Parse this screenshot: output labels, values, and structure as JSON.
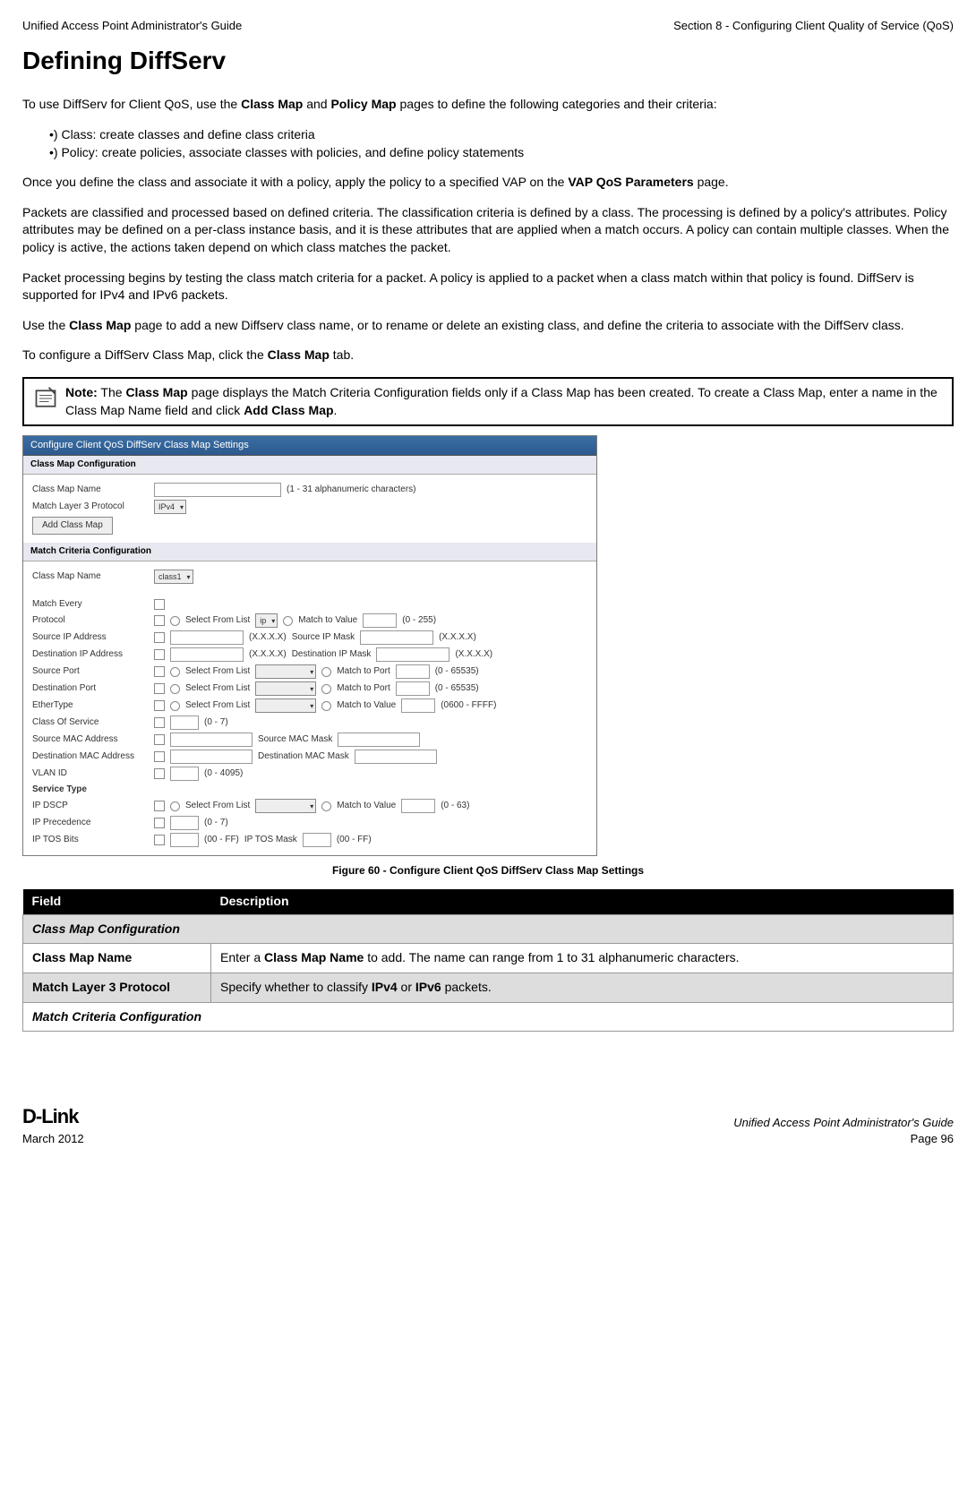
{
  "header": {
    "left": "Unified Access Point Administrator's Guide",
    "right": "Section 8 - Configuring Client Quality of Service (QoS)"
  },
  "title": "Defining DiffServ",
  "para1a": "To use DiffServ for Client QoS, use the ",
  "para1b": "Class Map",
  "para1c": " and ",
  "para1d": "Policy Map",
  "para1e": " pages to define the following categories and their criteria:",
  "bullet1": "•)  Class: create classes and define class criteria",
  "bullet2": "•)  Policy: create policies, associate classes with policies, and define policy statements",
  "para2a": "Once you define the class and associate it with a policy, apply the policy to a specified VAP on the ",
  "para2b": "VAP QoS Parameters",
  "para2c": " page.",
  "para3": "Packets are classified and processed based on defined criteria. The classification criteria is defined by a class. The processing is defined by a policy's attributes. Policy attributes may be defined on a per-class instance basis, and it is these attributes that are applied when a match occurs. A policy can contain multiple classes. When the policy is active, the actions taken depend on which class matches the packet.",
  "para4": "Packet processing begins by testing the class match criteria for a packet. A policy is applied to a packet when a class match within that policy is found. DiffServ is supported for IPv4 and IPv6 packets.",
  "para5a": "Use the ",
  "para5b": "Class Map",
  "para5c": " page to add a new Diffserv class name, or to rename or delete an existing class, and define the criteria to associate with the DiffServ class.",
  "para6a": "To configure a DiffServ Class Map, click the ",
  "para6b": "Class Map",
  "para6c": " tab.",
  "note": {
    "label": "Note:",
    "a": " The ",
    "b": "Class Map",
    "c": " page displays the Match Criteria Configuration fields only if a Class Map has been created. To create a Class Map, enter a name in the Class Map Name field and click ",
    "d": "Add Class Map",
    "e": "."
  },
  "fig": {
    "titlebar": "Configure Client QoS DiffServ Class Map Settings",
    "sec1": "Class Map Configuration",
    "cmn": "Class Map Name",
    "cmn_hint": "(1 - 31 alphanumeric characters)",
    "ml3": "Match Layer 3 Protocol",
    "ml3_val": "IPv4",
    "addbtn": "Add Class Map",
    "sec2": "Match Criteria Configuration",
    "cmn2_val": "class1",
    "rows": {
      "me": "Match Every",
      "proto": "Protocol",
      "sfl": "Select From List",
      "ip": "ip",
      "mtv": "Match to Value",
      "r0255": "(0 - 255)",
      "sip": "Source IP Address",
      "xxxx": "(X.X.X.X)",
      "sipm": "Source IP Mask",
      "dip": "Destination IP Address",
      "dipm": "Destination IP Mask",
      "sp": "Source Port",
      "mtp": "Match to Port",
      "r065535": "(0 - 65535)",
      "dp": "Destination Port",
      "et": "EtherType",
      "r0600": "(0600 - FFFF)",
      "cos": "Class Of Service",
      "r07": "(0 - 7)",
      "smac": "Source MAC Address",
      "smacm": "Source MAC Mask",
      "dmac": "Destination MAC Address",
      "dmacm": "Destination MAC Mask",
      "vlan": "VLAN ID",
      "r04095": "(0 - 4095)",
      "st": "Service Type",
      "dscp": "IP DSCP",
      "r063": "(0 - 63)",
      "ipp": "IP Precedence",
      "tos": "IP TOS Bits",
      "r00ff": "(00 - FF)",
      "tosm": "IP TOS Mask"
    }
  },
  "caption": "Figure 60 - Configure Client QoS DiffServ Class Map Settings",
  "table": {
    "h1": "Field",
    "h2": "Description",
    "r1": "Class Map Configuration",
    "r2f": "Class Map Name",
    "r2a": "Enter a ",
    "r2b": "Class Map Name",
    "r2c": " to add. The name can range from 1 to 31 alphanumeric characters.",
    "r3f": "Match Layer 3 Protocol",
    "r3a": "Specify whether to classify ",
    "r3b": "IPv4",
    "r3c": " or ",
    "r3d": "IPv6",
    "r3e": " packets.",
    "r4": "Match Criteria Configuration"
  },
  "footer": {
    "logo": "D-Link",
    "date": "March 2012",
    "right1": "Unified Access Point Administrator's Guide",
    "right2": "Page 96"
  }
}
